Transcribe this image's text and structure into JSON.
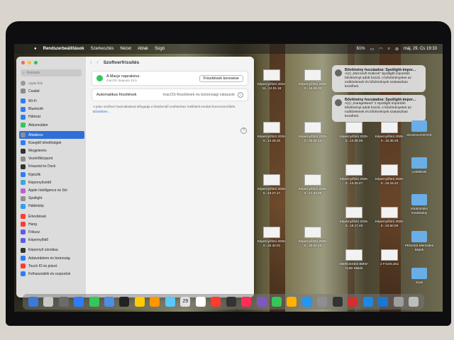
{
  "menubar": {
    "items": [
      "Rendszerbeállítások",
      "Szerkesztés",
      "Nézet",
      "Ablak",
      "Súgó"
    ],
    "battery": "61%",
    "clock": "máj. 29. Cs 19:33"
  },
  "window": {
    "search_placeholder": "Keresés",
    "user_name": "Apple-fiók",
    "sidebar": [
      {
        "label": "Család",
        "color": "#8a8a8a"
      },
      {
        "label": "Wi-Fi",
        "color": "#2f7df6"
      },
      {
        "label": "Bluetooth",
        "color": "#2f7df6"
      },
      {
        "label": "Hálózat",
        "color": "#2f7df6"
      },
      {
        "label": "Akkumulátor",
        "color": "#34c759"
      },
      {
        "label": "Általános",
        "color": "#8e8e93"
      },
      {
        "label": "Kisegítő lehetőségek",
        "color": "#2f7df6"
      },
      {
        "label": "Megjelenés",
        "color": "#333333"
      },
      {
        "label": "Vezérlőközpont",
        "color": "#8e8e93"
      },
      {
        "label": "Íróasztal és Dock",
        "color": "#333333"
      },
      {
        "label": "Kijelzők",
        "color": "#2f7df6"
      },
      {
        "label": "Képernyővédő",
        "color": "#3aa7e0"
      },
      {
        "label": "Apple Intelligence és Siri",
        "color": "#c05bd6"
      },
      {
        "label": "Spotlight",
        "color": "#8e8e93"
      },
      {
        "label": "Háttérkép",
        "color": "#2f9df6"
      },
      {
        "label": "Értesítések",
        "color": "#ff3b30"
      },
      {
        "label": "Hang",
        "color": "#ff3b30"
      },
      {
        "label": "Fókusz",
        "color": "#5e5ce6"
      },
      {
        "label": "Képernyőidő",
        "color": "#5e5ce6"
      },
      {
        "label": "Képernyő zárolása",
        "color": "#333333"
      },
      {
        "label": "Adatvédelem és biztonság",
        "color": "#2f7df6"
      },
      {
        "label": "Touch ID és jelszó",
        "color": "#ff3b30"
      },
      {
        "label": "Felhasználók és csoportok",
        "color": "#2f7df6"
      }
    ],
    "title": "Szoftverfrissítés",
    "status_line1": "A Macje naprakész.",
    "status_line2": "macOS Sequoia 15.5",
    "check_button": "Frissítések keresése",
    "auto_label": "Automatikus frissítések",
    "auto_value": "macOS-frissítések és biztonsági válaszok",
    "note": "A jelen szoftver használatával elfogadja a frissítendő szoftverhez mellékelt eredeti licencszerződés.",
    "note_link": "Bővebben...",
    "help": "?"
  },
  "notifications": [
    {
      "title": "Bővítmény hozzáadva: Spotlight-impor...",
      "body": "A(z) „Microsoft Outlook” Spotlight importáló bővítményt adott hozzá. A bővítményeket az Indítóelemek és bővítmények szakaszban kezelheti."
    },
    {
      "title": "Bővítmény hozzáadva: Spotlight-impor...",
      "body": "A(z) „GarageBand” 2 Spotlight importáló bővítményt adott hozzá. A bővítményeket az Indítóelemek és bővítmények szakaszban kezelheti."
    }
  ],
  "desktop": {
    "files": [
      "Képernyőfotó 2024-11...12.01.18",
      "Képernyőfotó 2025-0...15.36.20",
      "Képernyőfotó 2025-0...13.38.08",
      "Képernyőfotó 2025-0...15.38.28",
      "Képernyőfotó 2025-0...12.26.20",
      "Képernyőfotó 2025-0...20.38.13",
      "Képernyőfotó 2025-0...13.20.47",
      "Képernyőfotó 2025-0...15.15.42",
      "Képernyőfotó 2025-0...13.27.17",
      "Képernyőfotó 2025-0...17.43.05",
      "Képernyőfotó 2025-0...18.17.49",
      "Képernyőfotó 2025-0...10.50.09",
      "Képernyőfotó 2025-0...22.32.01",
      "Képernyőfotó 2025-0...20.04.46",
      "MERCEDES-BMW-AUDI Matek",
      "2 FÁZIS.xlsx"
    ],
    "folders": [
      "IGAZOLVANYOK",
      "Letöltések",
      "Kikülönítési rendelvény",
      "PENAES Mercedes képek",
      "Scan"
    ]
  },
  "dock": {
    "apps": [
      "#3a7bd5",
      "#c8c8c8",
      "#6b6b6b",
      "#2f7df6",
      "#34c759",
      "#4a90e2",
      "#222222",
      "#ffcc00",
      "#ff9500",
      "#5ac8fa",
      "#e0e0e0",
      "#ffffff",
      "#ff3b30",
      "#333333",
      "#ff2d55",
      "#7e57c2",
      "#34c759",
      "#ffb300",
      "#2196f3",
      "#8e8e93",
      "#333333",
      "#d32f2f",
      "#1e88e5",
      "#1976d2",
      "#9e9e9e",
      "#bdbdbd"
    ],
    "calendar_day": "29"
  }
}
